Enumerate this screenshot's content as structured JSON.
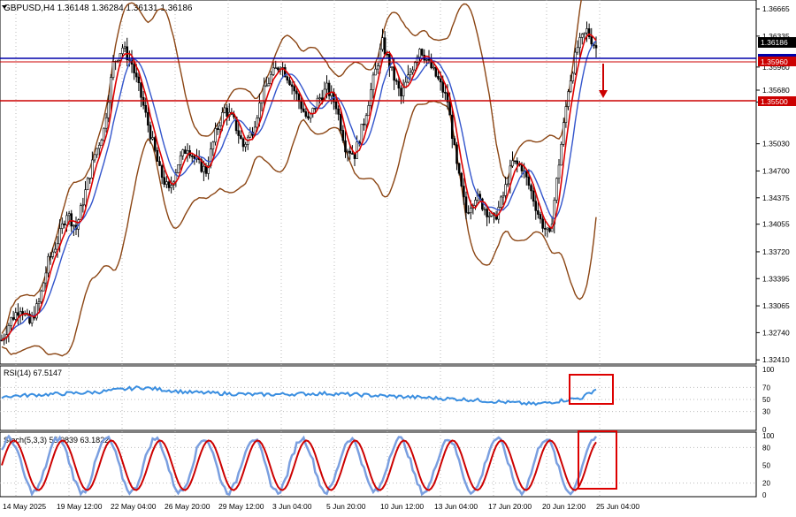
{
  "header": {
    "title": "GBPUSD,H4  1.36148 1.36284 1.36131 1.36186"
  },
  "main_panel": {
    "price_ticks": [
      "1.36665",
      "1.36335",
      "1.35960",
      "1.35680",
      "1.35535",
      "1.35030",
      "1.34700",
      "1.34375",
      "1.34055",
      "1.33720",
      "1.33395",
      "1.33065",
      "1.32740",
      "1.32410"
    ],
    "current_price": "1.36186",
    "level_blue": "1.35960",
    "level_red": "1.35500",
    "colors": {
      "blue_line": "#0000aa",
      "red_line": "#cc0000",
      "bollinger": "#8b4513",
      "ma_red": "#dd0000",
      "ma_blue": "#3355cc"
    }
  },
  "rsi_panel": {
    "label": "RSI(14) 67.5147",
    "ticks": [
      "100",
      "70",
      "50",
      "30",
      "0"
    ]
  },
  "stoch_panel": {
    "label": "Stoch(5,3,3) 55.0839 63.1822",
    "ticks": [
      "100",
      "80",
      "50",
      "20",
      "0"
    ]
  },
  "time_axis": {
    "labels": [
      "14 May 2025",
      "19 May 12:00",
      "22 May 04:00",
      "26 May 20:00",
      "29 May 12:00",
      "3 Jun 04:00",
      "5 Jun 20:00",
      "10 Jun 12:00",
      "13 Jun 04:00",
      "17 Jun 20:00",
      "20 Jun 12:00",
      "25 Jun 04:00"
    ]
  },
  "chart_data": {
    "type": "candlestick",
    "symbol": "GBPUSD",
    "timeframe": "H4",
    "ohlc_last": {
      "open": 1.36148,
      "high": 1.36284,
      "low": 1.36131,
      "close": 1.36186
    },
    "close_path": [
      [
        0,
        1.3265
      ],
      [
        4,
        1.329
      ],
      [
        8,
        1.3305
      ],
      [
        12,
        1.3285
      ],
      [
        16,
        1.331
      ],
      [
        20,
        1.336
      ],
      [
        24,
        1.3385
      ],
      [
        28,
        1.342
      ],
      [
        32,
        1.34
      ],
      [
        36,
        1.3445
      ],
      [
        40,
        1.349
      ],
      [
        44,
        1.352
      ],
      [
        48,
        1.36
      ],
      [
        52,
        1.362
      ],
      [
        56,
        1.36
      ],
      [
        60,
        1.356
      ],
      [
        64,
        1.3515
      ],
      [
        68,
        1.347
      ],
      [
        72,
        1.3445
      ],
      [
        76,
        1.348
      ],
      [
        80,
        1.35
      ],
      [
        84,
        1.348
      ],
      [
        88,
        1.347
      ],
      [
        92,
        1.3515
      ],
      [
        96,
        1.3545
      ],
      [
        100,
        1.353
      ],
      [
        104,
        1.35
      ],
      [
        108,
        1.352
      ],
      [
        112,
        1.356
      ],
      [
        116,
        1.3585
      ],
      [
        120,
        1.36
      ],
      [
        124,
        1.358
      ],
      [
        128,
        1.3555
      ],
      [
        132,
        1.353
      ],
      [
        136,
        1.3555
      ],
      [
        140,
        1.357
      ],
      [
        144,
        1.355
      ],
      [
        148,
        1.35
      ],
      [
        152,
        1.349
      ],
      [
        156,
        1.353
      ],
      [
        160,
        1.358
      ],
      [
        164,
        1.3625
      ],
      [
        168,
        1.359
      ],
      [
        172,
        1.356
      ],
      [
        176,
        1.359
      ],
      [
        180,
        1.362
      ],
      [
        184,
        1.36
      ],
      [
        188,
        1.358
      ],
      [
        192,
        1.3555
      ],
      [
        196,
        1.3475
      ],
      [
        200,
        1.342
      ],
      [
        204,
        1.344
      ],
      [
        208,
        1.3425
      ],
      [
        212,
        1.341
      ],
      [
        216,
        1.344
      ],
      [
        220,
        1.348
      ],
      [
        224,
        1.3475
      ],
      [
        228,
        1.3445
      ],
      [
        232,
        1.341
      ],
      [
        236,
        1.339
      ],
      [
        240,
        1.348
      ],
      [
        244,
        1.357
      ],
      [
        248,
        1.362
      ],
      [
        252,
        1.364
      ],
      [
        256,
        1.3619
      ]
    ],
    "rsi_path": [
      [
        0,
        55
      ],
      [
        40,
        62
      ],
      [
        60,
        70
      ],
      [
        80,
        62
      ],
      [
        110,
        58
      ],
      [
        140,
        60
      ],
      [
        170,
        55
      ],
      [
        200,
        50
      ],
      [
        230,
        42
      ],
      [
        250,
        53
      ],
      [
        256,
        67.5
      ]
    ],
    "stoch_path": [
      [
        0,
        20
      ],
      [
        20,
        90
      ],
      [
        40,
        15
      ],
      [
        60,
        95
      ],
      [
        80,
        10
      ],
      [
        100,
        90
      ],
      [
        120,
        20
      ],
      [
        140,
        85
      ],
      [
        160,
        15
      ],
      [
        180,
        90
      ],
      [
        200,
        10
      ],
      [
        220,
        85
      ],
      [
        240,
        15
      ],
      [
        250,
        95
      ],
      [
        256,
        55
      ]
    ]
  }
}
